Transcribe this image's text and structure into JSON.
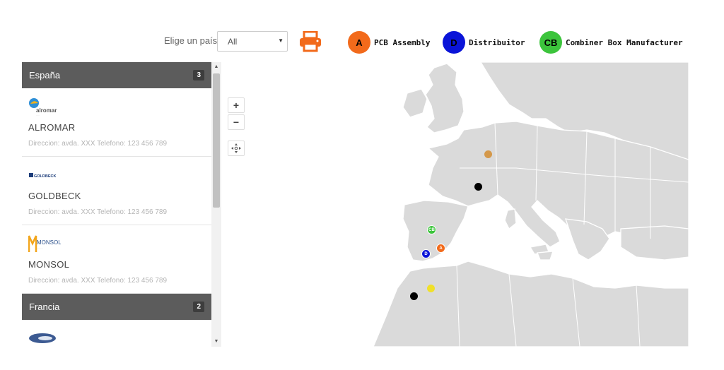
{
  "filter": {
    "label": "Elige un país",
    "selected": "All"
  },
  "legend": [
    {
      "letter": "A",
      "label": "PCB Assembly",
      "color": "#f26a1b"
    },
    {
      "letter": "D",
      "label": "Distribuitor",
      "color": "#0a14d8"
    },
    {
      "letter": "CB",
      "label": "Combiner Box Manufacturer",
      "color": "#3cc43c"
    }
  ],
  "sidebar": {
    "groups": [
      {
        "name": "España",
        "count": "3",
        "companies": [
          {
            "logo_text": "alromar",
            "name": "ALROMAR",
            "address": "Direccion: avda. XXX Telefono: 123 456 789"
          },
          {
            "logo_text": "GOLDBECK",
            "name": "GOLDBECK",
            "address": "Direccion: avda. XXX Telefono: 123 456 789"
          },
          {
            "logo_text": "MONSOL",
            "name": "MONSOL",
            "address": "Direccion: avda. XXX Telefono: 123 456 789"
          }
        ]
      },
      {
        "name": "Francia",
        "count": "2"
      }
    ]
  },
  "map_controls": {
    "zoom_in": "+",
    "zoom_out": "−"
  },
  "markers": [
    {
      "label": "CB",
      "color": "#3cc43c"
    },
    {
      "label": "A",
      "color": "#f26a1b"
    },
    {
      "label": "D",
      "color": "#0a14d8"
    },
    {
      "label": "",
      "color": "#d4984a"
    },
    {
      "label": "",
      "color": "#000000"
    },
    {
      "label": "",
      "color": "#000000"
    },
    {
      "label": "",
      "color": "#f0e02a"
    }
  ],
  "colors": {
    "print_icon": "#f26a1b",
    "header_bg": "#5c5c5c",
    "land": "#dadada"
  }
}
